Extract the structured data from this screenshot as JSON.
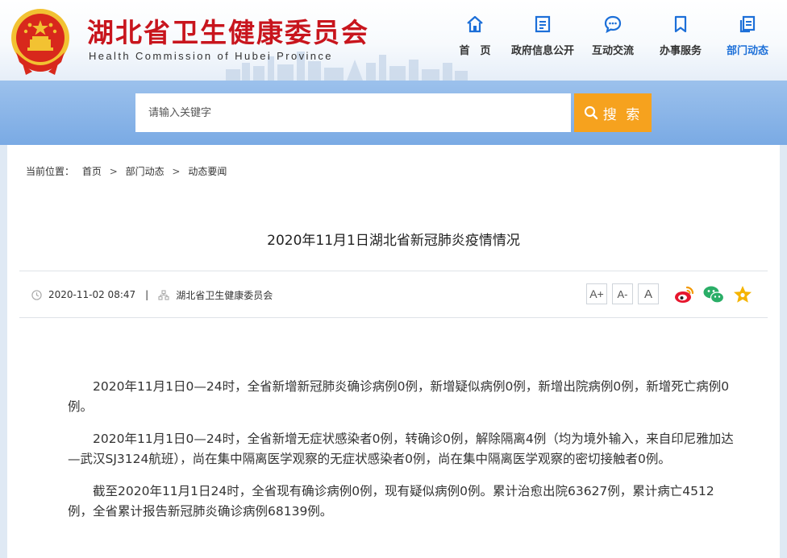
{
  "header": {
    "title": "湖北省卫生健康委员会",
    "subtitle": "Health Commission of Hubei Province",
    "nav": [
      {
        "label": "首　页",
        "icon": "home-icon"
      },
      {
        "label": "政府信息公开",
        "icon": "document-icon"
      },
      {
        "label": "互动交流",
        "icon": "chat-bubble-icon"
      },
      {
        "label": "办事服务",
        "icon": "bookmark-icon"
      },
      {
        "label": "部门动态",
        "icon": "copy-pages-icon"
      }
    ],
    "active_nav_color": "#1c6fd8",
    "title_color": "#c8151d"
  },
  "search": {
    "placeholder": "请输入关键字",
    "button_label": "搜 索",
    "button_color": "#f6a21e"
  },
  "breadcrumb": {
    "prefix": "当前位置：",
    "items": [
      "首页",
      "部门动态",
      "动态要闻"
    ],
    "separator": ">"
  },
  "article": {
    "title": "2020年11月1日湖北省新冠肺炎疫情情况",
    "date": "2020-11-02 08:47",
    "meta_separator": "|",
    "source": "湖北省卫生健康委员会",
    "font_controls": [
      "A+",
      "A-",
      "A"
    ],
    "share": [
      {
        "icon": "weibo-icon",
        "color": "#e6162d"
      },
      {
        "icon": "wechat-icon",
        "color": "#2aae67"
      },
      {
        "icon": "favorite-star-icon",
        "color": "#f5b400"
      }
    ],
    "paragraphs": [
      "2020年11月1日0—24时，全省新增新冠肺炎确诊病例0例，新增疑似病例0例，新增出院病例0例，新增死亡病例0例。",
      "2020年11月1日0—24时，全省新增无症状感染者0例，转确诊0例，解除隔离4例（均为境外输入，来自印尼雅加达—武汉SJ3124航班），尚在集中隔离医学观察的无症状感染者0例，尚在集中隔离医学观察的密切接触者0例。",
      "截至2020年11月1日24时，全省现有确诊病例0例，现有疑似病例0例。累计治愈出院63627例，累计病亡4512例，全省累计报告新冠肺炎确诊病例68139例。"
    ]
  }
}
